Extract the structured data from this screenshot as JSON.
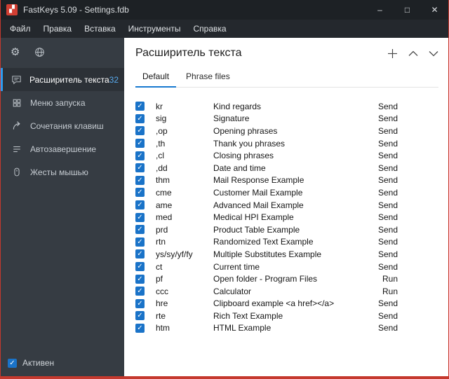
{
  "window": {
    "title": "FastKeys 5.09  - Settings.fdb",
    "controls": {
      "minimize": "–",
      "maximize": "□",
      "close": "✕"
    }
  },
  "menubar": {
    "items": [
      "Файл",
      "Правка",
      "Вставка",
      "Инструменты",
      "Справка"
    ]
  },
  "sidebar": {
    "top_icons": [
      {
        "id": "settings",
        "icon": "gear-icon"
      },
      {
        "id": "language",
        "icon": "globe-icon"
      }
    ],
    "items": [
      {
        "id": "text-expander",
        "label": "Расширитель текста",
        "icon": "speech-bubble-icon",
        "badge": "32",
        "active": true
      },
      {
        "id": "start-menu",
        "label": "Меню запуска",
        "icon": "grid-icon",
        "badge": "",
        "active": false
      },
      {
        "id": "shortcuts",
        "label": "Сочетания клавиш",
        "icon": "share-arrow-icon",
        "badge": "",
        "active": false
      },
      {
        "id": "autocomplete",
        "label": "Автозавершение",
        "icon": "list-icon",
        "badge": "",
        "active": false
      },
      {
        "id": "mouse-gestures",
        "label": "Жесты мышью",
        "icon": "mouse-icon",
        "badge": "",
        "active": false
      }
    ],
    "status_label": "Активен",
    "status_checked": true
  },
  "main": {
    "title": "Расширитель текста",
    "header_icons": [
      "plus-icon",
      "chevron-up-icon",
      "chevron-down-icon"
    ],
    "tabs": [
      {
        "id": "default",
        "label": "Default",
        "active": true
      },
      {
        "id": "phrase-files",
        "label": "Phrase files",
        "active": false
      }
    ],
    "rows": [
      {
        "abbr": "kr",
        "desc": "Kind regards",
        "action": "Send",
        "checked": true
      },
      {
        "abbr": "sig",
        "desc": "Signature",
        "action": "Send",
        "checked": true
      },
      {
        "abbr": ",op",
        "desc": "Opening phrases",
        "action": "Send",
        "checked": true
      },
      {
        "abbr": ",th",
        "desc": "Thank you phrases",
        "action": "Send",
        "checked": true
      },
      {
        "abbr": ",cl",
        "desc": "Closing phrases",
        "action": "Send",
        "checked": true
      },
      {
        "abbr": ",dd",
        "desc": "Date and time",
        "action": "Send",
        "checked": true
      },
      {
        "abbr": "thm",
        "desc": "Mail Response Example",
        "action": "Send",
        "checked": true
      },
      {
        "abbr": "cme",
        "desc": "Customer Mail Example",
        "action": "Send",
        "checked": true
      },
      {
        "abbr": "ame",
        "desc": "Advanced Mail Example",
        "action": "Send",
        "checked": true
      },
      {
        "abbr": "med",
        "desc": "Medical HPI Example",
        "action": "Send",
        "checked": true
      },
      {
        "abbr": "prd",
        "desc": "Product Table Example",
        "action": "Send",
        "checked": true
      },
      {
        "abbr": "rtn",
        "desc": "Randomized Text Example",
        "action": "Send",
        "checked": true
      },
      {
        "abbr": "ys/sy/yf/fy",
        "desc": "Multiple Substitutes Example",
        "action": "Send",
        "checked": true
      },
      {
        "abbr": "ct",
        "desc": "Current time",
        "action": "Send",
        "checked": true
      },
      {
        "abbr": "pf",
        "desc": "Open folder - Program Files",
        "action": "Run",
        "checked": true
      },
      {
        "abbr": "ccc",
        "desc": "Calculator",
        "action": "Run",
        "checked": true
      },
      {
        "abbr": "hre",
        "desc": "Clipboard example <a href></a>",
        "action": "Send",
        "checked": true
      },
      {
        "abbr": "rte",
        "desc": "Rich Text Example",
        "action": "Send",
        "checked": true
      },
      {
        "abbr": "htm",
        "desc": "HTML Example",
        "action": "Send",
        "checked": true
      }
    ]
  },
  "colors": {
    "accent_blue": "#1779d0",
    "checkbox_blue": "#1a73c8",
    "badge_blue": "#58a9ec",
    "brand_red": "#c5392e",
    "sidebar_bg": "#363c43",
    "titlebar_bg": "#1d2125"
  }
}
